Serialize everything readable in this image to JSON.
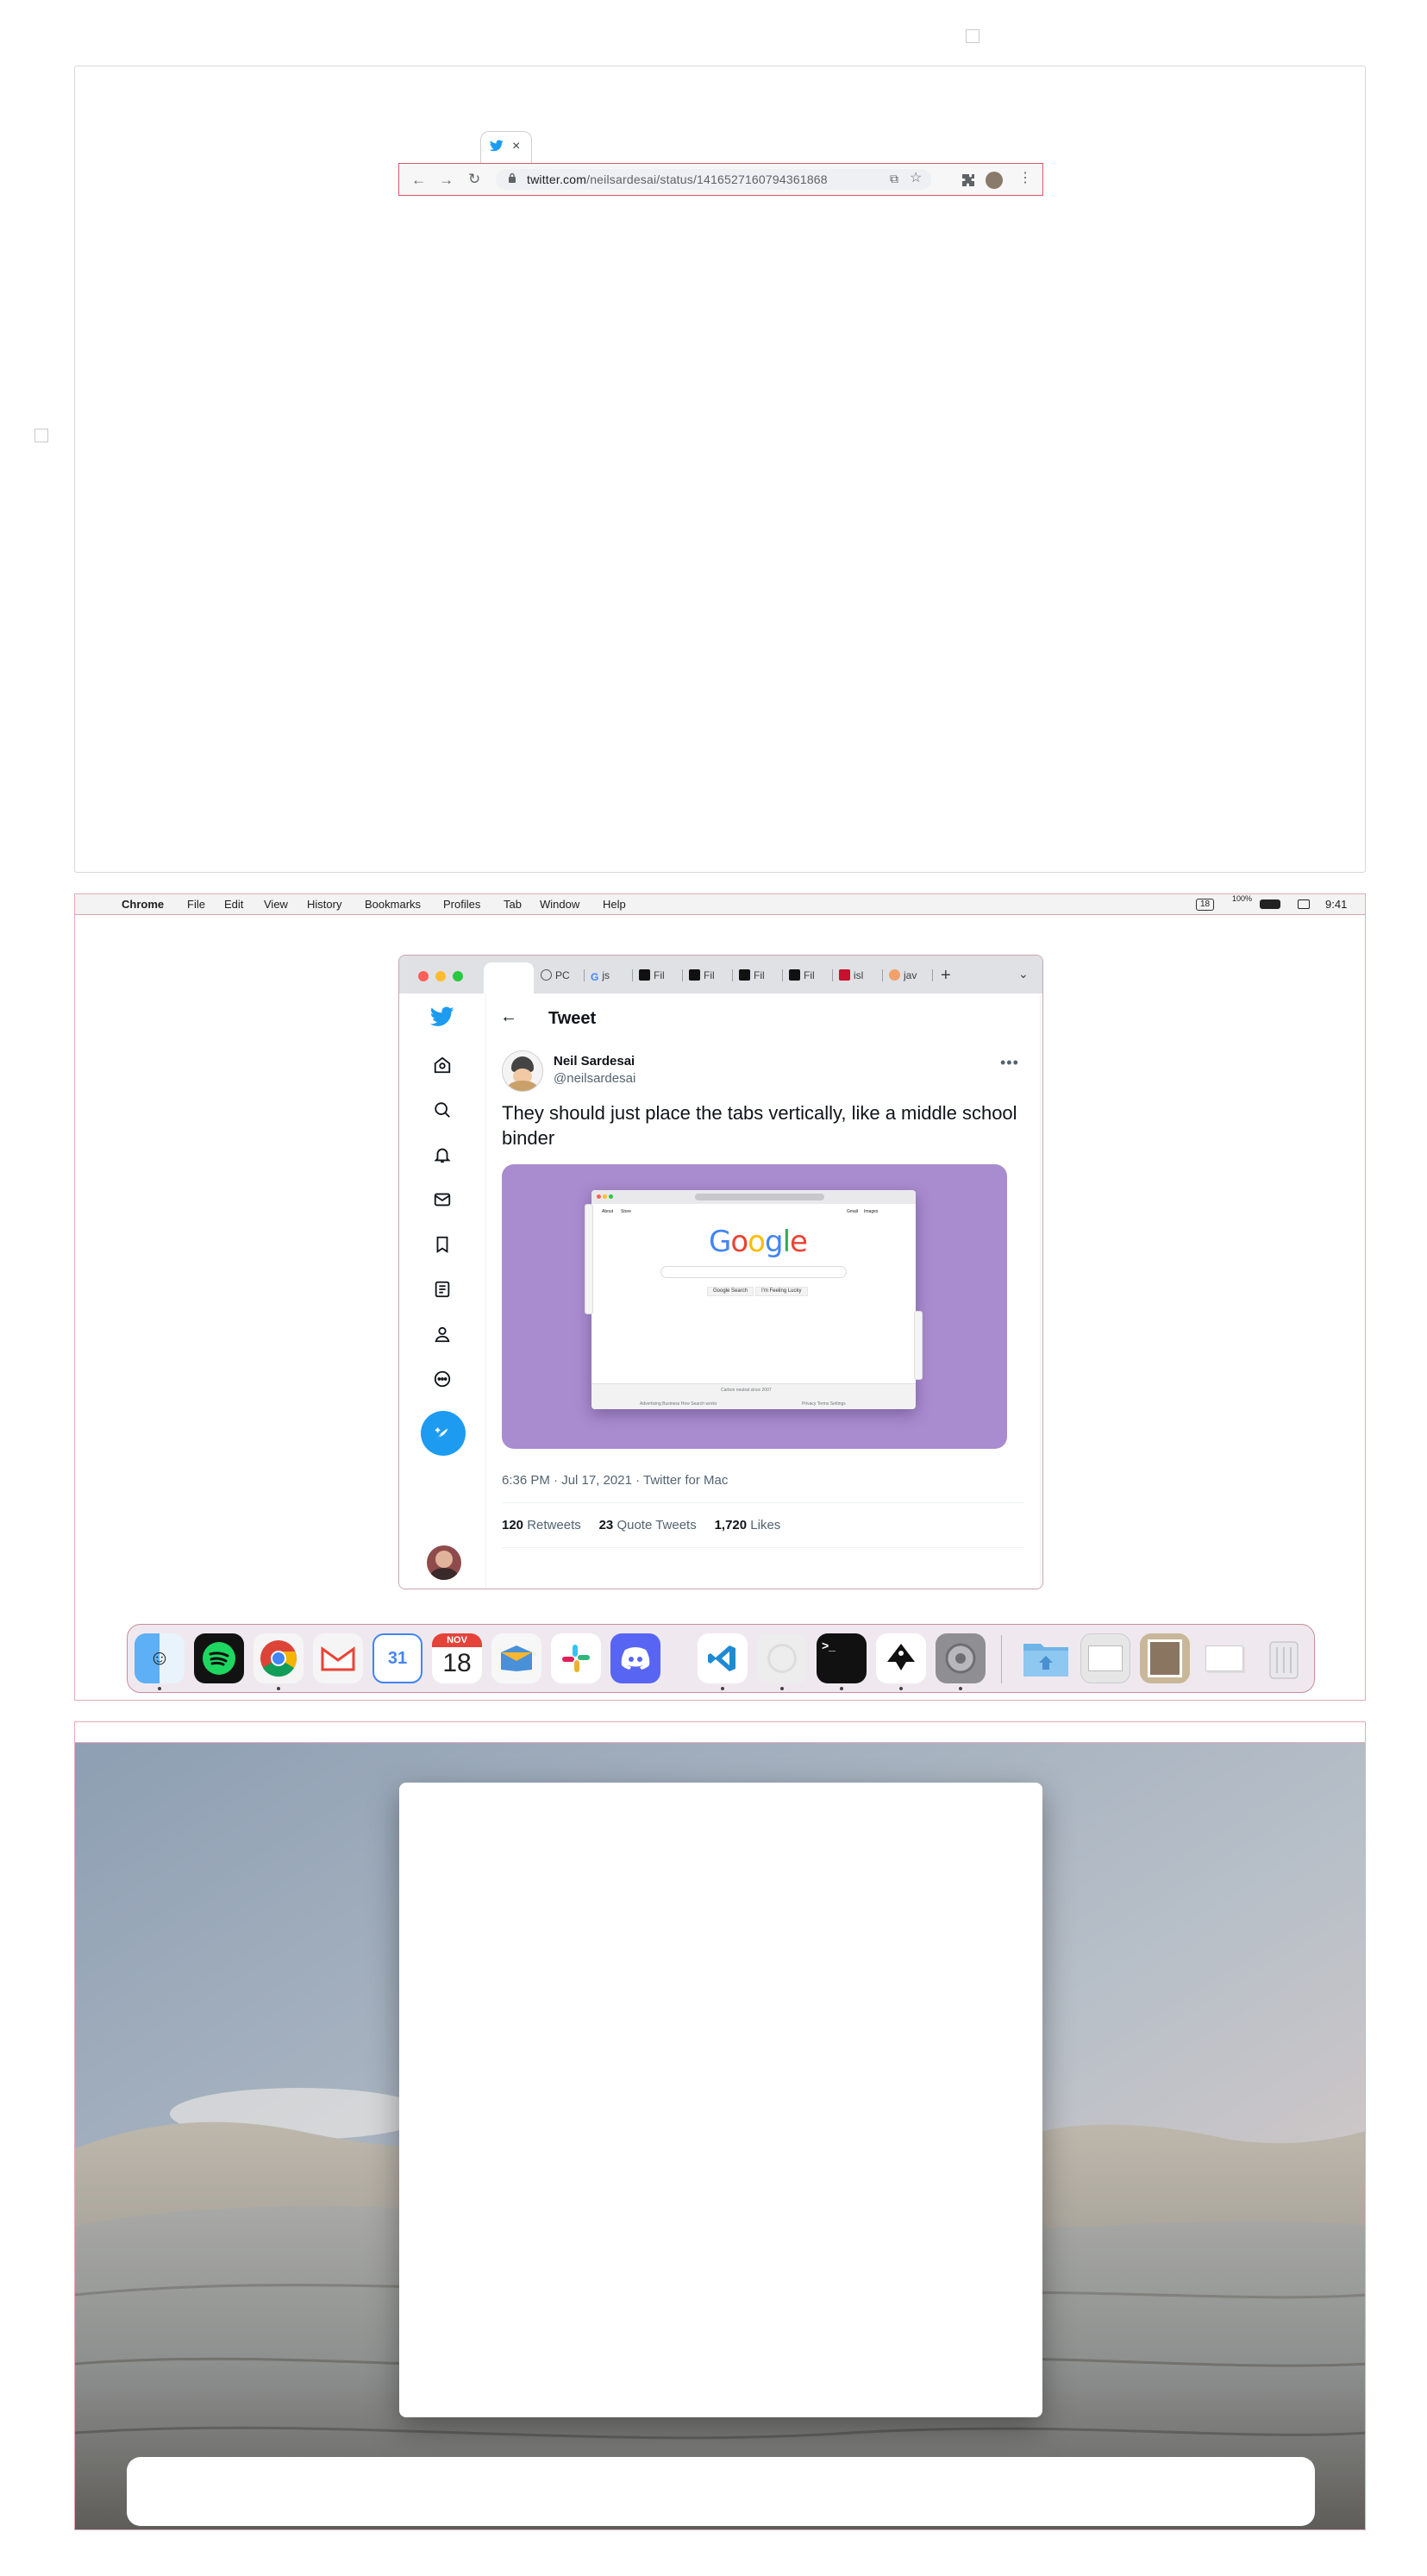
{
  "panel1": {
    "url_host": "twitter.com",
    "url_path": "/neilsardesai/status/1416527160794361868",
    "tab_close": "×"
  },
  "menubar": {
    "app_name": "Chrome",
    "items": [
      "File",
      "Edit",
      "View",
      "History",
      "Bookmarks",
      "Profiles",
      "Tab",
      "Window",
      "Help"
    ],
    "calendar_badge": "18",
    "battery_label": "100%",
    "time": "9:41"
  },
  "tabs": [
    {
      "label": "PC",
      "icon": "globe-icon"
    },
    {
      "label": "js",
      "icon": "google-icon"
    },
    {
      "label": "Fil",
      "icon": "figma-icon"
    },
    {
      "label": "Fil",
      "icon": "figma-icon"
    },
    {
      "label": "Fil",
      "icon": "figma-icon"
    },
    {
      "label": "Fil",
      "icon": "figma-icon"
    },
    {
      "label": "isl",
      "icon": "red-icon"
    },
    {
      "label": "jav",
      "icon": "pencil-icon"
    }
  ],
  "tweet": {
    "header_title": "Tweet",
    "author_name": "Neil Sardesai",
    "author_handle": "@neilsardesai",
    "text": "They should just place the tabs vertically, like a middle school binder",
    "meta": "6:36 PM · Jul 17, 2021 · Twitter for Mac",
    "retweets_count": "120",
    "retweets_label": "Retweets",
    "quotes_count": "23",
    "quotes_label": "Quote Tweets",
    "likes_count": "1,720",
    "likes_label": "Likes"
  },
  "embedded_screenshot": {
    "logo": "Google",
    "link_left_1": "About",
    "link_left_2": "Store",
    "link_right_1": "Gmail",
    "link_right_2": "Images",
    "btn_search": "Google Search",
    "btn_lucky": "I'm Feeling Lucky",
    "footer_center": "Carbon neutral since 2007",
    "footer_links_left": "Advertising   Business   How Search works",
    "footer_links_right": "Privacy   Terms   Settings"
  },
  "dock": {
    "calendar_month": "NOV",
    "calendar_day": "18",
    "gcal_day": "31",
    "terminal_prompt": ">_"
  },
  "colors": {
    "twitter_blue": "#1d9bf0",
    "media_purple": "#a98ccf",
    "panel_border": "#e2aeb8"
  }
}
